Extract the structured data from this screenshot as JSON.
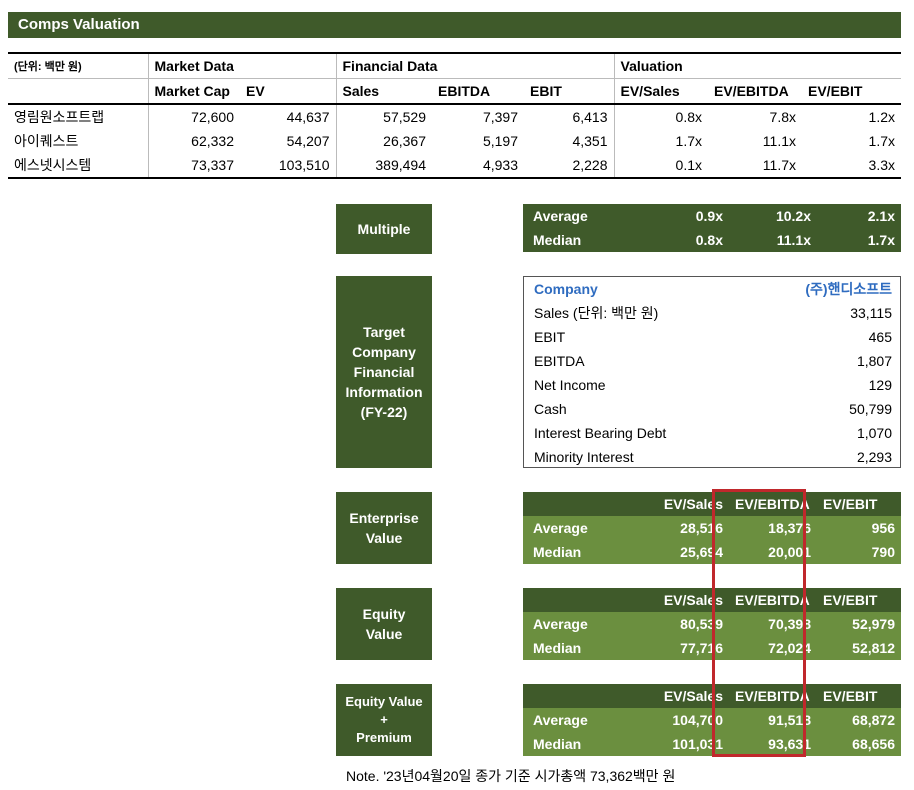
{
  "title": "Comps Valuation",
  "comps": {
    "unit": "(단위: 백만 원)",
    "group_headers": [
      "Market Data",
      "Financial Data",
      "Valuation"
    ],
    "columns": [
      "Market Cap",
      "EV",
      "Sales",
      "EBITDA",
      "EBIT",
      "EV/Sales",
      "EV/EBITDA",
      "EV/EBIT"
    ],
    "rows": [
      {
        "name": "영림원소프트랩",
        "values": [
          "72,600",
          "44,637",
          "57,529",
          "7,397",
          "6,413",
          "0.8x",
          "7.8x",
          "1.2x"
        ]
      },
      {
        "name": "아이퀘스트",
        "values": [
          "62,332",
          "54,207",
          "26,367",
          "5,197",
          "4,351",
          "1.7x",
          "11.1x",
          "1.7x"
        ]
      },
      {
        "name": "에스넷시스템",
        "values": [
          "73,337",
          "103,510",
          "389,494",
          "4,933",
          "2,228",
          "0.1x",
          "11.7x",
          "3.3x"
        ]
      }
    ]
  },
  "multiple": {
    "label": "Multiple",
    "rows": [
      {
        "name": "Average",
        "values": [
          "0.9x",
          "10.2x",
          "2.1x"
        ]
      },
      {
        "name": "Median",
        "values": [
          "0.8x",
          "11.1x",
          "1.7x"
        ]
      }
    ]
  },
  "target": {
    "label_lines": [
      "Target",
      "Company",
      "Financial",
      "Information",
      "(FY-22)"
    ],
    "header_left": "Company",
    "header_right": "(주)핸디소프트",
    "rows": [
      {
        "name": "Sales (단위: 백만 원)",
        "value": "33,115"
      },
      {
        "name": "EBIT",
        "value": "465"
      },
      {
        "name": "EBITDA",
        "value": "1,807"
      },
      {
        "name": "Net Income",
        "value": "129"
      },
      {
        "name": "Cash",
        "value": "50,799"
      },
      {
        "name": "Interest Bearing Debt",
        "value": "1,070"
      },
      {
        "name": "Minority Interest",
        "value": "2,293"
      }
    ]
  },
  "val_headers": [
    "EV/Sales",
    "EV/EBITDA",
    "EV/EBIT"
  ],
  "enterprise_value": {
    "label_lines": [
      "Enterprise",
      "Value"
    ],
    "rows": [
      {
        "name": "Average",
        "values": [
          "28,516",
          "18,376",
          "956"
        ]
      },
      {
        "name": "Median",
        "values": [
          "25,694",
          "20,001",
          "790"
        ]
      }
    ]
  },
  "equity_value": {
    "label_lines": [
      "Equity",
      "Value"
    ],
    "rows": [
      {
        "name": "Average",
        "values": [
          "80,539",
          "70,398",
          "52,979"
        ]
      },
      {
        "name": "Median",
        "values": [
          "77,716",
          "72,024",
          "52,812"
        ]
      }
    ]
  },
  "equity_premium": {
    "label_lines": [
      "Equity Value",
      "+",
      "Premium"
    ],
    "rows": [
      {
        "name": "Average",
        "values": [
          "104,700",
          "91,518",
          "68,872"
        ]
      },
      {
        "name": "Median",
        "values": [
          "101,031",
          "93,631",
          "68,656"
        ]
      }
    ]
  },
  "note": "Note. '23년04월20일 종가 기준 시가총액 73,362백만 원",
  "colors": {
    "dark_green": "#3f5a2a",
    "light_green": "#6b8f3f",
    "highlight_red": "#c0282c",
    "company_blue": "#2f6cc0"
  }
}
